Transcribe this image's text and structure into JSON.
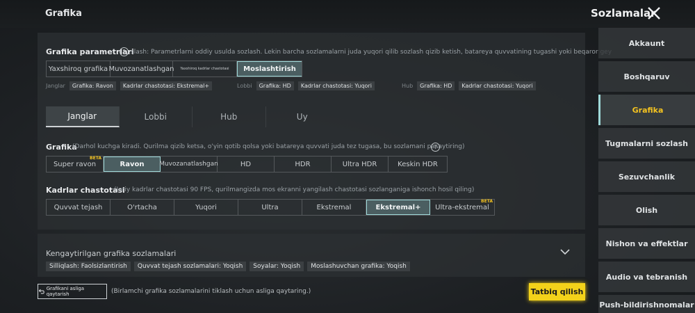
{
  "header": {
    "title": "Grafika",
    "settings_title": "Sozlamalar"
  },
  "colors": {
    "accent_teal": "#9fd9d9",
    "apply_yellow": "#f3d21a",
    "beta_gold": "#f4c320"
  },
  "style_section": {
    "label": "Grafika parametrlari",
    "desc": "slash: Parametrlarni oddiy usulda sozlash. Lekin barcha sozlamalarni juda yuqori qilib sozlash qizib ketish, batareya quvvatining tugashi yoki beqaror gey",
    "options": [
      "Yaxshiroq grafika",
      "Muvozanatlashgan",
      "Yaxshiroq kadrlar chastotasi",
      "Moslashtirish"
    ],
    "selected": "Moslashtirish",
    "presets": [
      {
        "label": "Janglar",
        "grafika": "Grafika: Ravon",
        "fps": "Kadrlar chastotasi: Ekstremal+"
      },
      {
        "label": "Lobbi",
        "grafika": "Grafika: HD",
        "fps": "Kadrlar chastotasi: Yuqori"
      },
      {
        "label": "Hub",
        "grafika": "Grafika: HD",
        "fps": "Kadrlar chastotasi: Yuqori"
      }
    ]
  },
  "mode_tabs": [
    "Janglar",
    "Lobbi",
    "Hub",
    "Uy"
  ],
  "graphics": {
    "label": "Grafika",
    "desc": "(Darhol kuchga kiradi. Qurilma qizib ketsa, o'yin qotib qolsa yoki batareya quvvati juda tez tugasa, bu sozlamani pasaytiring)",
    "options": [
      "Super ravon",
      "Ravon",
      "Muvozanatlashgan",
      "HD",
      "HDR",
      "Ultra HDR",
      "Keskin HDR"
    ],
    "beta_badge": "BETA",
    "selected": "Ravon"
  },
  "fps": {
    "label": "Kadrlar chastotasi",
    "desc": "(Joriy kadrlar chastotasi 90 FPS, qurilmangizda mos ekranni yangilash chastotasi sozlanganiga ishonch hosil qiling)",
    "options": [
      "Quvvat tejash",
      "O'rtacha",
      "Yuqori",
      "Ultra",
      "Ekstremal",
      "Ekstremal+",
      "Ultra-ekstremal"
    ],
    "beta_badge": "BETA",
    "selected": "Ekstremal+"
  },
  "advanced": {
    "title": "Kengaytirilgan grafika sozlamalari",
    "chips": [
      "Silliqlash: Faolsizlantirish",
      "Quvvat tejash sozlamalari: Yoqish",
      "Soyalar: Yoqish",
      "Moslashuvchan grafika: Yoqish"
    ]
  },
  "footer": {
    "reset_label": "Grafikani asliga qaytarish",
    "reset_note": "(Birlamchi grafika sozlamalarini tiklash uchun asliga qaytaring.)",
    "apply_label": "Tatbiq qilish"
  },
  "sidebar": {
    "items": [
      "Akkaunt",
      "Boshqaruv",
      "Grafika",
      "Tugmalarni sozlash",
      "Sezuvchanlik",
      "Olish",
      "Nishon va effektlar",
      "Audio va tebranish",
      "Push-bildirishnomalar"
    ],
    "active": "Grafika"
  }
}
